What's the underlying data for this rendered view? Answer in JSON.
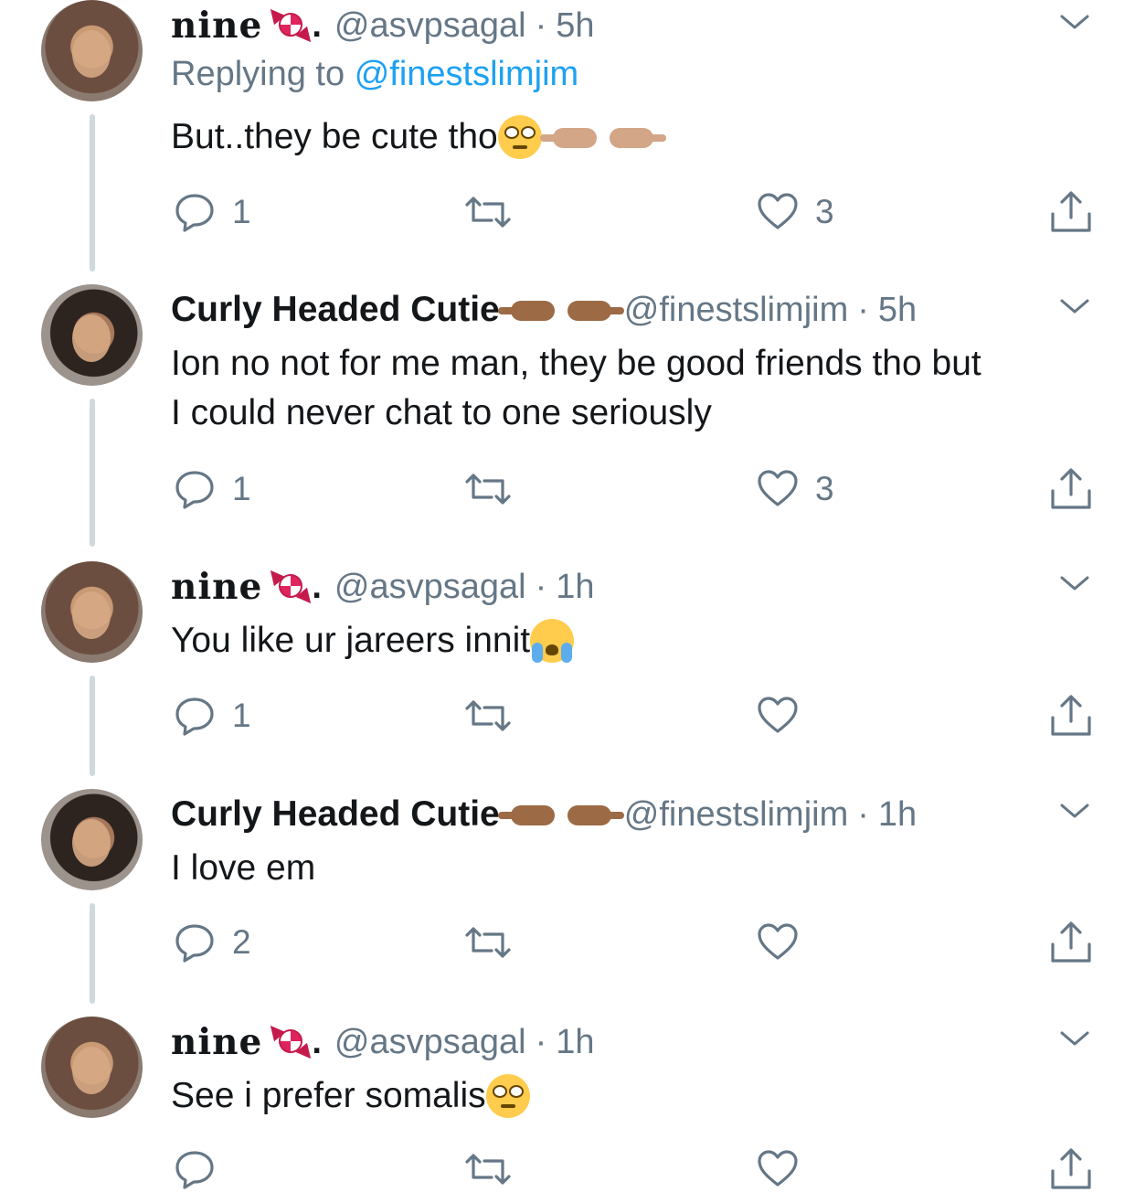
{
  "tweets": [
    {
      "name": "nine",
      "name_style": "gothic",
      "name_emoji": "candy-icon",
      "handle": "@asvpsagal",
      "time": "5h",
      "replying_prefix": "Replying to",
      "replying_to": "@finestslimjim",
      "body_lines": [
        "But..they be cute tho"
      ],
      "body_emoji": [
        "pleading-face-icon",
        "pointing-hands-icon"
      ],
      "replies": "1",
      "retweets": "",
      "likes": "3"
    },
    {
      "name": "Curly Headed Cutie",
      "name_style": "bold",
      "name_emoji": "pointing-hands-icon",
      "handle": "@finestslimjim",
      "time": "5h",
      "body_lines": [
        "Ion no not for me man, they be good friends tho but",
        "I could never chat to one seriously"
      ],
      "replies": "1",
      "retweets": "",
      "likes": "3"
    },
    {
      "name": "nine",
      "name_style": "gothic",
      "name_emoji": "candy-icon",
      "handle": "@asvpsagal",
      "time": "1h",
      "body_lines": [
        "You like ur jareers innit"
      ],
      "body_emoji": [
        "loudly-crying-face-icon"
      ],
      "replies": "1",
      "retweets": "",
      "likes": ""
    },
    {
      "name": "Curly Headed Cutie",
      "name_style": "bold",
      "name_emoji": "pointing-hands-icon",
      "handle": "@finestslimjim",
      "time": "1h",
      "body_lines": [
        "I love em"
      ],
      "replies": "2",
      "retweets": "",
      "likes": ""
    },
    {
      "name": "nine",
      "name_style": "gothic",
      "name_emoji": "candy-icon",
      "handle": "@asvpsagal",
      "time": "1h",
      "body_lines": [
        "See i prefer somalis"
      ],
      "body_emoji": [
        "pleading-face-icon"
      ],
      "replies": "",
      "retweets": "",
      "likes": ""
    }
  ],
  "separator": "·",
  "colors": {
    "text": "#14171a",
    "secondary": "#657786",
    "link": "#1da1f2",
    "thread_line": "#cfd9de",
    "icon": "#657786"
  }
}
